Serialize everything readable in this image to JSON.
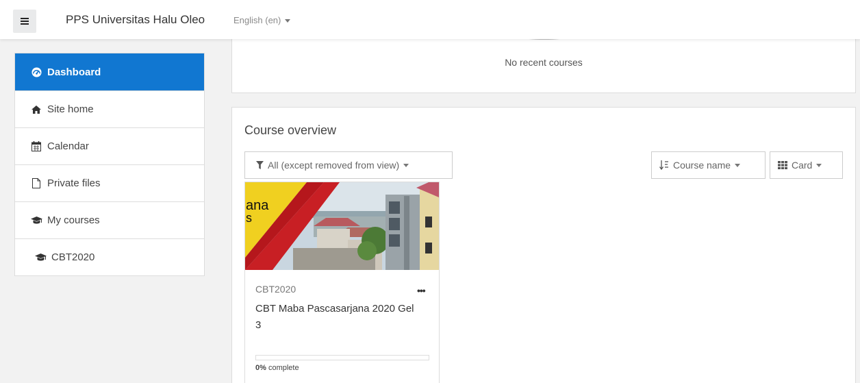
{
  "navbar": {
    "site_name": "PPS Universitas Halu Oleo",
    "language": "English (en)"
  },
  "sidebar": {
    "items": [
      {
        "label": "Dashboard",
        "icon": "dashboard-icon",
        "active": true
      },
      {
        "label": "Site home",
        "icon": "home-icon"
      },
      {
        "label": "Calendar",
        "icon": "calendar-icon"
      },
      {
        "label": "Private files",
        "icon": "file-icon"
      },
      {
        "label": "My courses",
        "icon": "graduation-cap-icon"
      },
      {
        "label": "CBT2020",
        "icon": "graduation-cap-icon"
      }
    ]
  },
  "recent": {
    "empty_text": "No recent courses"
  },
  "overview": {
    "title": "Course overview",
    "filter_label": "All (except removed from view)",
    "sort_label": "Course name",
    "view_label": "Card",
    "course": {
      "short_name": "CBT2020",
      "full_name": "CBT Maba Pascasarjana 2020 Gel 3",
      "image_text_1": "ana",
      "image_text_2": "s",
      "progress_value": "0%",
      "progress_suffix": " complete",
      "progress_fraction": 0
    }
  },
  "colors": {
    "accent": "#1177d1",
    "background": "#f2f2f2",
    "banner_red": "#b5171c",
    "banner_yellow": "#f0d020"
  }
}
